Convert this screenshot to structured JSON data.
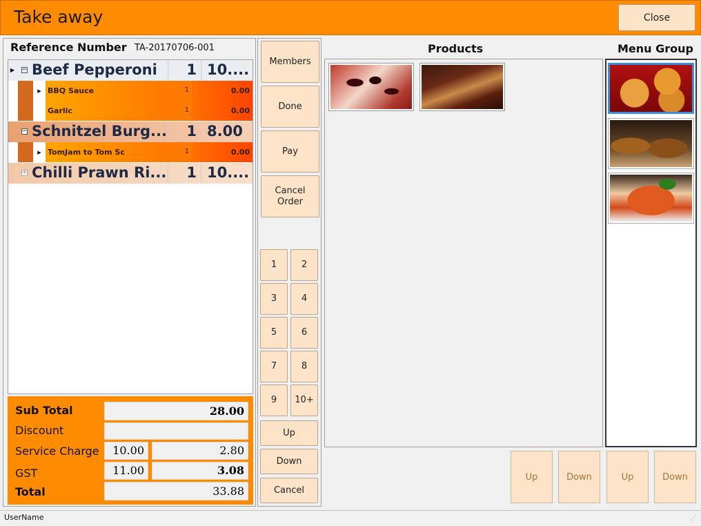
{
  "window": {
    "title": "Take away",
    "close_label": "Close"
  },
  "order": {
    "reference_label": "Reference Number",
    "reference_value": "TA-20170706-001",
    "items": [
      {
        "name": "Beef Pepperoni",
        "qty": "1",
        "price": "10....",
        "modifiers": [
          {
            "name": "BBQ Sauce",
            "qty": "1",
            "price": "0.00"
          },
          {
            "name": "Garlic",
            "qty": "1",
            "price": "0.00"
          }
        ]
      },
      {
        "name": "Schnitzel Burg...",
        "qty": "1",
        "price": "8.00",
        "modifiers": [
          {
            "name": "TomJam to Tom Sc",
            "qty": "1",
            "price": "0.00"
          }
        ]
      },
      {
        "name": "Chilli Prawn Ri...",
        "qty": "1",
        "price": "10....",
        "modifiers": []
      }
    ]
  },
  "totals": {
    "subtotal_label": "Sub Total",
    "subtotal_value": "28.00",
    "discount_label": "Discount",
    "discount_value": "",
    "service_label": "Service Charge",
    "service_rate": "10.00",
    "service_value": "2.80",
    "gst_label": "GST",
    "gst_rate": "11.00",
    "gst_value": "3.08",
    "total_label": "Total",
    "total_value": "33.88"
  },
  "actions": {
    "members": "Members",
    "done": "Done",
    "pay": "Pay",
    "cancel_order": "Cancel Order"
  },
  "keypad": {
    "keys": [
      "1",
      "2",
      "3",
      "4",
      "5",
      "6",
      "7",
      "8",
      "9",
      "10+"
    ],
    "up": "Up",
    "down": "Down",
    "cancel": "Cancel"
  },
  "products": {
    "title": "Products",
    "up": "Up",
    "down": "Down"
  },
  "menu_group": {
    "title": "Menu Group",
    "up": "Up",
    "down": "Down"
  },
  "status": {
    "username": "UserName"
  },
  "colors": {
    "accent": "#ff8c00",
    "button": "#fde4c8"
  }
}
